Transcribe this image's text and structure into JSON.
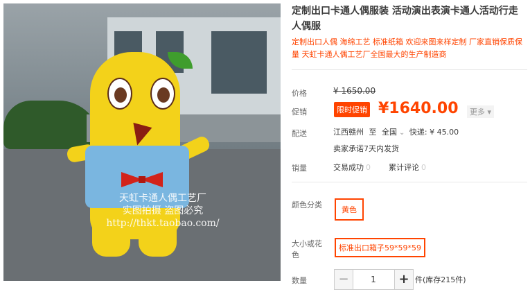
{
  "product": {
    "title": "定制出口卡通人偶服装 活动演出表演卡通人活动行走人偶服",
    "subtitle": "定制出口人偶 海绵工艺 标准纸箱 欢迎来图来样定制 厂家直销保质保量 天虹卡通人偶工艺厂全国最大的生产制造商",
    "image_watermark": [
      "天虹卡通人偶工艺厂",
      "实图拍摄 盗图必究",
      "http://thkt.taobao.com/"
    ]
  },
  "price": {
    "label": "价格",
    "original": "¥ 1650.00",
    "promo_label": "促销",
    "promo_badge": "限时促销",
    "current": "¥1640.00",
    "more": "更多"
  },
  "shipping": {
    "label": "配送",
    "from": "江西赣州",
    "to_word": "至",
    "to": "全国",
    "express": "快递: ¥ 45.00",
    "promise": "卖家承诺7天内发货"
  },
  "sales": {
    "label": "销量",
    "deals_label": "交易成功",
    "deals": "0",
    "reviews_label": "累计评论",
    "reviews": "0"
  },
  "options": {
    "color_label": "颜色分类",
    "color_value": "黄色",
    "size_label": "大小或花色",
    "size_value": "标准出口箱子59*59*59"
  },
  "quantity": {
    "label": "数量",
    "minus": "−",
    "value": "1",
    "plus": "+",
    "stock": "件(库存215件)"
  },
  "colors": {
    "accent": "#ff4400",
    "mascot_yellow": "#f3d21a",
    "shirt_blue": "#7ab6e0"
  }
}
